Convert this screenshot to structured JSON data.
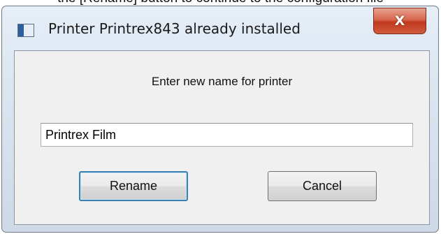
{
  "background_text": "the [Rename] button to continue to the configuration file",
  "window": {
    "title": "Printer Printrex843 already installed",
    "close_label": "X"
  },
  "dialog": {
    "prompt": "Enter new name for printer",
    "name_input_value": "Printrex Film",
    "rename_label": "Rename",
    "cancel_label": "Cancel"
  },
  "colors": {
    "close_button": "#c0391f",
    "default_button_border": "#3c7fb1"
  }
}
